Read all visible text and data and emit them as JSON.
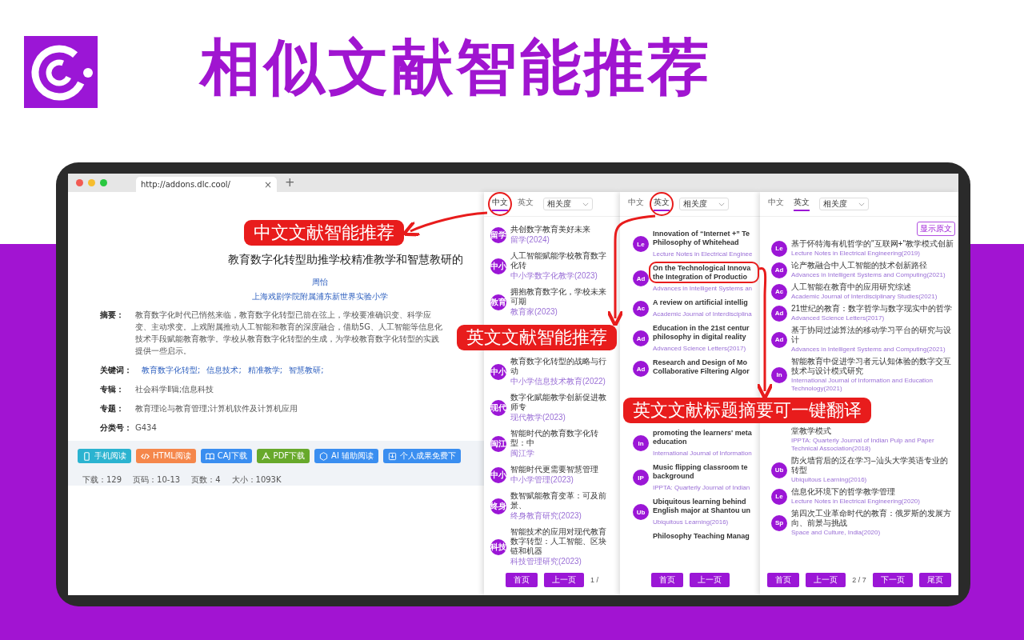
{
  "headline": "相似文献智能推荐",
  "browser": {
    "tab_title": "http://addons.dlc.cool/",
    "close": "×",
    "new_tab": "+"
  },
  "article": {
    "title": "教育数字化转型助推学校精准教学和智慧教研的",
    "author": "周怡",
    "affiliation": "上海戏剧学院附属浦东新世界实验小学",
    "fields": [
      {
        "kind": "text",
        "label": "摘要：",
        "value": "教育数字化时代已悄然来临，教育数字化转型已箭在弦上，学校要准确识变、科学应变、主动求变。上戏附属推动人工智能和教育的深度融合，借助5G、人工智能等信息化技术手段赋能教育教学。学校从教育数字化转型的生成，为学校教育数字化转型的实践提供一些启示。"
      },
      {
        "kind": "links",
        "label": "关键词：",
        "values": [
          "教育数字化转型;",
          "信息技术;",
          "精准教学;",
          "智慧教研;"
        ]
      },
      {
        "kind": "text",
        "label": "专辑：",
        "value": "社会科学Ⅱ辑;信息科技"
      },
      {
        "kind": "text",
        "label": "专题：",
        "value": "教育理论与教育管理;计算机软件及计算机应用"
      },
      {
        "kind": "text",
        "label": "分类号：",
        "value": "G434"
      }
    ],
    "buttons": [
      {
        "kind": "phone",
        "label": "手机阅读",
        "color": "#2bb3d0"
      },
      {
        "kind": "code",
        "label": "HTML阅读",
        "color": "#f5874b"
      },
      {
        "kind": "book",
        "label": "CAJ下载",
        "color": "#3a8ef0"
      },
      {
        "kind": "pdf",
        "label": "PDF下载",
        "color": "#67a92b"
      },
      {
        "kind": "ai",
        "label": "AI 辅助阅读",
        "color": "#3a8ef0"
      },
      {
        "kind": "download",
        "label": "个人成果免费下",
        "color": "#3a8ef0"
      }
    ],
    "stats": [
      "下载：129",
      "页码：10-13",
      "页数：4",
      "大小：1093K"
    ]
  },
  "panels": [
    {
      "tabs": [
        {
          "label": "中文",
          "selected": true
        },
        {
          "label": "英文",
          "selected": false
        }
      ],
      "sort": "相关度",
      "items": [
        {
          "badge": "留学",
          "title": "共创数字教育美好未来",
          "source": "留学(2024)"
        },
        {
          "badge": "中小",
          "title": "人工智能赋能学校教育数字化转",
          "source": "中小学数字化教学(2023)"
        },
        {
          "badge": "教育",
          "title": "拥抱教育数字化，学校未来可期",
          "source": "教育家(2023)"
        },
        {
          "badge": "中小",
          "title": "教育数字化转型的战略与行动",
          "source": "中小学信息技术教育(2022)"
        },
        {
          "badge": "现代",
          "title": "数字化赋能教学创新促进教师专",
          "source": "现代教学(2023)"
        },
        {
          "badge": "闽江",
          "title": "智能时代的教育数字化转型：中",
          "source": "闽江学"
        },
        {
          "badge": "中小",
          "title": "智能时代更需要智慧管理",
          "source": "中小学管理(2023)"
        },
        {
          "badge": "终身",
          "title": "数智赋能教育变革：可及前景、",
          "source": "终身教育研究(2023)"
        },
        {
          "badge": "科技",
          "title": "智能技术的应用对现代教育数字转型：人工智能、区块链和机器",
          "source": "科技管理研究(2023)"
        }
      ],
      "pager": [
        "首页",
        "上一页"
      ],
      "page": "1 /"
    },
    {
      "tabs": [
        {
          "label": "中文",
          "selected": false
        },
        {
          "label": "英文",
          "selected": true
        }
      ],
      "sort": "相关度",
      "items": [
        {
          "badge": "Le",
          "title": "Innovation of “Internet +” Te Philosophy of Whitehead",
          "source": "Lecture Notes in Electrical Enginee"
        },
        {
          "badge": "Ad",
          "title": "On the Technological Innova the Integration of Productio",
          "source": "Advances in Intelligent Systems an"
        },
        {
          "badge": "Ac",
          "title": "A review on artificial intellig",
          "source": "Academic Journal of Interdisciplina"
        },
        {
          "badge": "Ad",
          "title": "Education in the 21st centur philosophy in digital reality",
          "source": "Advanced Science Letters(2017)"
        },
        {
          "badge": "Ad",
          "title": "Research and Design of Mo Collaborative Filtering Algor"
        },
        {
          "badge": "In",
          "title": "promoting the learners' meta education",
          "source": "International Journal of Information"
        },
        {
          "badge": "IP",
          "title": "Music flipping classroom te background",
          "source": "IPPTA: Quarterly Journal of Indian"
        },
        {
          "badge": "Ub",
          "title": "Ubiquitous learning behind English major at Shantou un",
          "source": "Ubiquitous Learning(2016)"
        },
        {
          "title": "Philosophy Teaching Manag"
        }
      ],
      "pager": [
        "首页",
        "上一页"
      ]
    },
    {
      "tabs": [
        {
          "label": "中文",
          "selected": false
        },
        {
          "label": "英文",
          "selected": true
        }
      ],
      "sort": "相关度",
      "toggle": "显示原文",
      "items": [
        {
          "badge": "Le",
          "title": "基于怀特海有机哲学的\"互联网+\"教学模式创新",
          "source": "Lecture Notes in Electrical Engineering(2019)"
        },
        {
          "badge": "Ad",
          "title": "论产教融合中人工智能的技术创新路径",
          "source": "Advances in Intelligent Systems and Computing(2021)"
        },
        {
          "badge": "Ac",
          "title": "人工智能在教育中的应用研究综述",
          "source": "Academic Journal of Interdisciplinary Studies(2021)"
        },
        {
          "badge": "Ad",
          "title": "21世纪的教育：数字哲学与数字现实中的哲学",
          "source": "Advanced Science Letters(2017)"
        },
        {
          "badge": "Ad",
          "title": "基于协同过滤算法的移动学习平台的研究与设计",
          "source": "Advances in Intelligent Systems and Computing(2021)"
        },
        {
          "badge": "In",
          "title": "智能教育中促进学习者元认知体验的数字交互技术与设计模式研究",
          "source": "International Journal of Information and Education Technology(2021)"
        },
        {
          "title": "堂教学模式",
          "source": "IPPTA: Quarterly Journal of Indian Pulp and Paper Technical Association(2018)"
        },
        {
          "badge": "Ub",
          "title": "防火墙背后的泛在学习–汕头大学英语专业的转型",
          "source": "Ubiquitous Learning(2016)"
        },
        {
          "badge": "Le",
          "title": "信息化环境下的哲学教学管理",
          "source": "Lecture Notes in Electrical Engineering(2020)"
        },
        {
          "badge": "Sp",
          "title": "第四次工业革命时代的教育：俄罗斯的发展方向、前景与挑战",
          "source": "Space and Culture, India(2020)"
        }
      ],
      "pager": [
        "首页",
        "上一页",
        "下一页",
        "尾页"
      ],
      "page": "2 / 7"
    }
  ],
  "callouts": [
    "中文文献智能推荐",
    "英文文献智能推荐",
    "英文文献标题摘要可一键翻译"
  ]
}
